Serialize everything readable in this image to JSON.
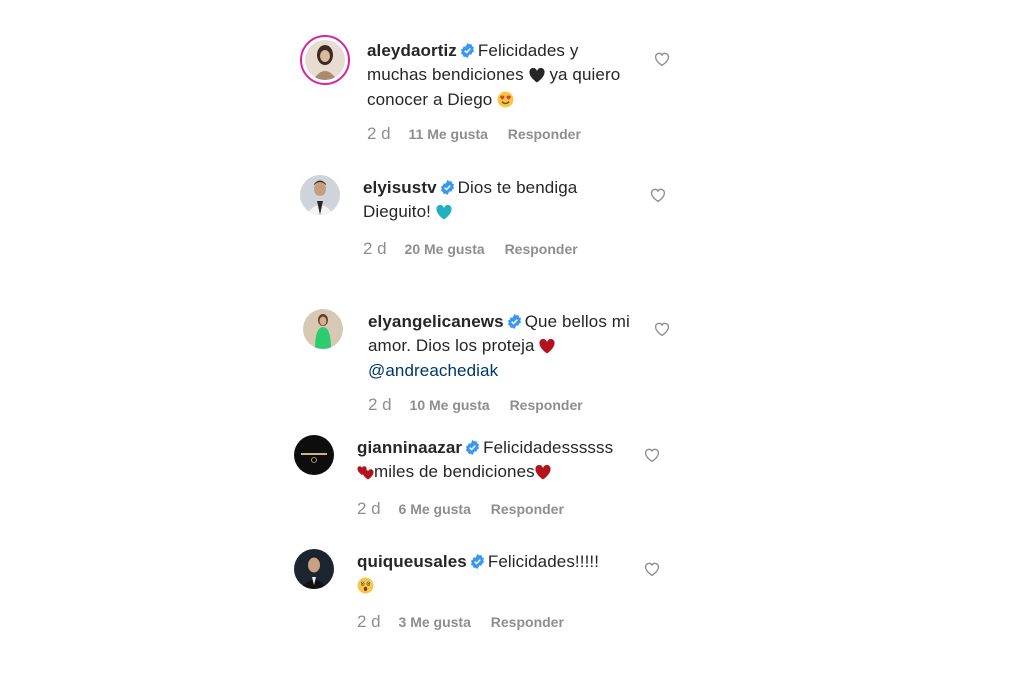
{
  "colors": {
    "verified": "#3897f0",
    "muted": "#8e8e8e",
    "heart_red": "#b3141c",
    "heart_black": "#262626",
    "heart_teal": "#1fb0c2"
  },
  "comments": [
    {
      "username": "aleydaortiz",
      "text_parts": [
        "Felicidades y muchas bendiciones",
        " ya quiero conocer a Diego"
      ],
      "emojis": [
        "black-heart-icon",
        "heart-eyes-icon"
      ],
      "time": "2 d",
      "likes": "11 Me gusta",
      "reply": "Responder"
    },
    {
      "username": "elyisustv",
      "text_parts": [
        "Dios te bendiga Dieguito!"
      ],
      "emojis": [
        "teal-heart-icon"
      ],
      "time": "2 d",
      "likes": "20 Me gusta",
      "reply": "Responder"
    },
    {
      "username": "elyangelicanews",
      "text_parts": [
        "Que bellos mi amor. Dios los proteja"
      ],
      "mention": "@andreachediak",
      "emojis": [
        "red-heart-icon"
      ],
      "time": "2 d",
      "likes": "10 Me gusta",
      "reply": "Responder"
    },
    {
      "username": "gianninaazar",
      "text_parts": [
        "Felicidadessssss",
        "miles de bendiciones"
      ],
      "emojis": [
        "two-hearts-icon",
        "red-heart-icon"
      ],
      "time": "2 d",
      "likes": "6 Me gusta",
      "reply": "Responder"
    },
    {
      "username": "quiqueusales",
      "text_parts": [
        "Felicidades!!!!!"
      ],
      "emojis": [
        "astonished-face-icon"
      ],
      "time": "2 d",
      "likes": "3 Me gusta",
      "reply": "Responder"
    }
  ]
}
